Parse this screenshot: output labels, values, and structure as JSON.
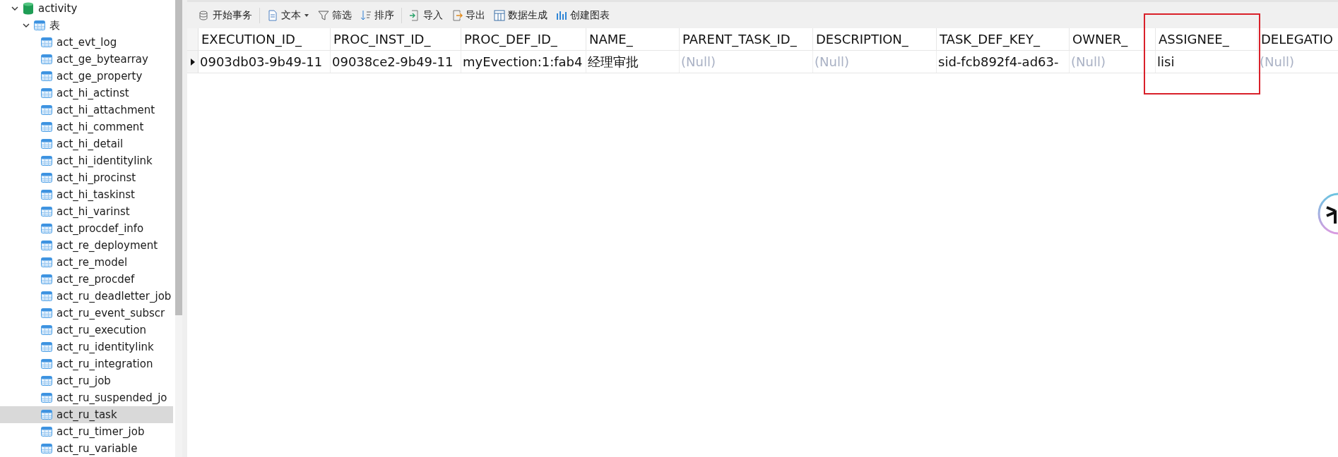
{
  "tree": {
    "label": "activity",
    "expanded": true,
    "children": [
      {
        "label": "表",
        "expanded": true,
        "children": [
          {
            "label": "act_evt_log",
            "selected": false
          },
          {
            "label": "act_ge_bytearray",
            "selected": false
          },
          {
            "label": "act_ge_property",
            "selected": false
          },
          {
            "label": "act_hi_actinst",
            "selected": false
          },
          {
            "label": "act_hi_attachment",
            "selected": false
          },
          {
            "label": "act_hi_comment",
            "selected": false
          },
          {
            "label": "act_hi_detail",
            "selected": false
          },
          {
            "label": "act_hi_identitylink",
            "selected": false
          },
          {
            "label": "act_hi_procinst",
            "selected": false
          },
          {
            "label": "act_hi_taskinst",
            "selected": false
          },
          {
            "label": "act_hi_varinst",
            "selected": false
          },
          {
            "label": "act_procdef_info",
            "selected": false
          },
          {
            "label": "act_re_deployment",
            "selected": false
          },
          {
            "label": "act_re_model",
            "selected": false
          },
          {
            "label": "act_re_procdef",
            "selected": false
          },
          {
            "label": "act_ru_deadletter_job",
            "selected": false
          },
          {
            "label": "act_ru_event_subscr",
            "selected": false
          },
          {
            "label": "act_ru_execution",
            "selected": false
          },
          {
            "label": "act_ru_identitylink",
            "selected": false
          },
          {
            "label": "act_ru_integration",
            "selected": false
          },
          {
            "label": "act_ru_job",
            "selected": false
          },
          {
            "label": "act_ru_suspended_jo",
            "selected": false
          },
          {
            "label": "act_ru_task",
            "selected": true
          },
          {
            "label": "act_ru_timer_job",
            "selected": false
          },
          {
            "label": "act_ru_variable",
            "selected": false
          }
        ]
      }
    ]
  },
  "toolbar": [
    [
      {
        "kind": "transaction",
        "label": "开始事务",
        "dropdown": false
      }
    ],
    [
      {
        "kind": "text",
        "label": "文本",
        "dropdown": true
      },
      {
        "kind": "filter",
        "label": "筛选",
        "dropdown": false
      },
      {
        "kind": "sort",
        "label": "排序",
        "dropdown": false
      }
    ],
    [
      {
        "kind": "import",
        "label": "导入",
        "dropdown": false
      },
      {
        "kind": "export",
        "label": "导出",
        "dropdown": false
      },
      {
        "kind": "generate",
        "label": "数据生成",
        "dropdown": false
      },
      {
        "kind": "chart",
        "label": "创建图表",
        "dropdown": false
      }
    ]
  ],
  "table": {
    "columns": [
      {
        "label": "EXECUTION_ID_",
        "highlighted": false
      },
      {
        "label": "PROC_INST_ID_",
        "highlighted": false
      },
      {
        "label": "PROC_DEF_ID_",
        "highlighted": false
      },
      {
        "label": "NAME_",
        "highlighted": false
      },
      {
        "label": "PARENT_TASK_ID_",
        "highlighted": false
      },
      {
        "label": "DESCRIPTION_",
        "highlighted": false
      },
      {
        "label": "TASK_DEF_KEY_",
        "highlighted": false
      },
      {
        "label": "OWNER_",
        "highlighted": false
      },
      {
        "label": "ASSIGNEE_",
        "highlighted": true
      },
      {
        "label": "DELEGATIO",
        "highlighted": false
      }
    ],
    "rows": [
      {
        "current": true,
        "cells": [
          {
            "kind": "value",
            "text": "0903db03-9b49-11"
          },
          {
            "kind": "value",
            "text": "09038ce2-9b49-11"
          },
          {
            "kind": "value",
            "text": "myEvection:1:fab4"
          },
          {
            "kind": "value",
            "text": "经理审批"
          },
          {
            "kind": "null",
            "text": "(Null)"
          },
          {
            "kind": "null",
            "text": "(Null)"
          },
          {
            "kind": "value",
            "text": "sid-fcb892f4-ad63-"
          },
          {
            "kind": "null",
            "text": "(Null)"
          },
          {
            "kind": "value",
            "text": "lisi"
          },
          {
            "kind": "null",
            "text": "(Null)"
          }
        ]
      }
    ]
  }
}
